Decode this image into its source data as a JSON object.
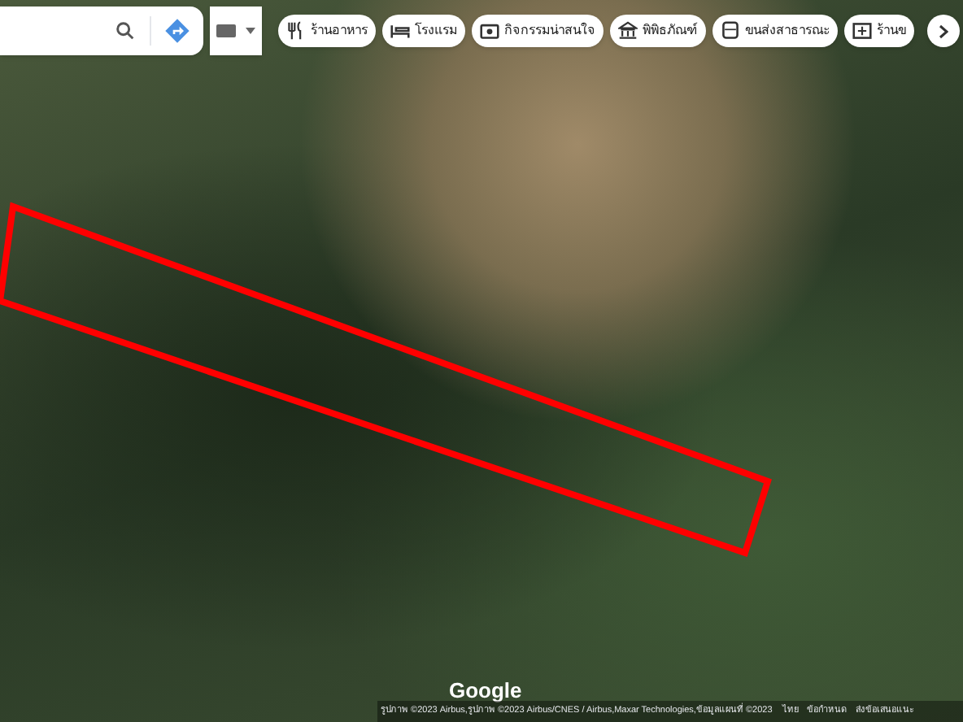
{
  "chips": [
    {
      "label": "ร้านอาหาร",
      "kind": "restaurant"
    },
    {
      "label": "โรงแรม",
      "kind": "hotel"
    },
    {
      "label": "กิจกรรมน่าสนใจ",
      "kind": "camera"
    },
    {
      "label": "พิพิธภัณฑ์",
      "kind": "museum"
    },
    {
      "label": "ขนส่งสาธารณะ",
      "kind": "transit"
    },
    {
      "label": "ร้านข",
      "kind": "pharmacy"
    }
  ],
  "logo": "Google",
  "attribution": "รูปภาพ ©2023 Airbus,รูปภาพ ©2023 Airbus/CNES / Airbus,Maxar Technologies,ข้อมูลแผนที่ ©2023",
  "footer_links": [
    "ไทย",
    "ข้อกำหนด",
    "ส่งข้อเสนอแนะ"
  ]
}
